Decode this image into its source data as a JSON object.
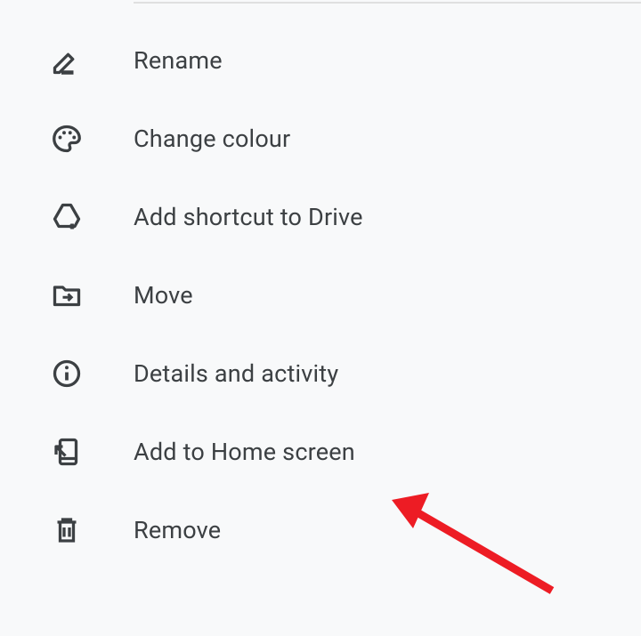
{
  "menu": {
    "items": [
      {
        "label": "Rename"
      },
      {
        "label": "Change colour"
      },
      {
        "label": "Add shortcut to Drive"
      },
      {
        "label": "Move"
      },
      {
        "label": "Details and activity"
      },
      {
        "label": "Add to Home screen"
      },
      {
        "label": "Remove"
      }
    ]
  },
  "annotation": {
    "arrow_color": "#ed1c24",
    "points_to": "Add to Home screen"
  }
}
